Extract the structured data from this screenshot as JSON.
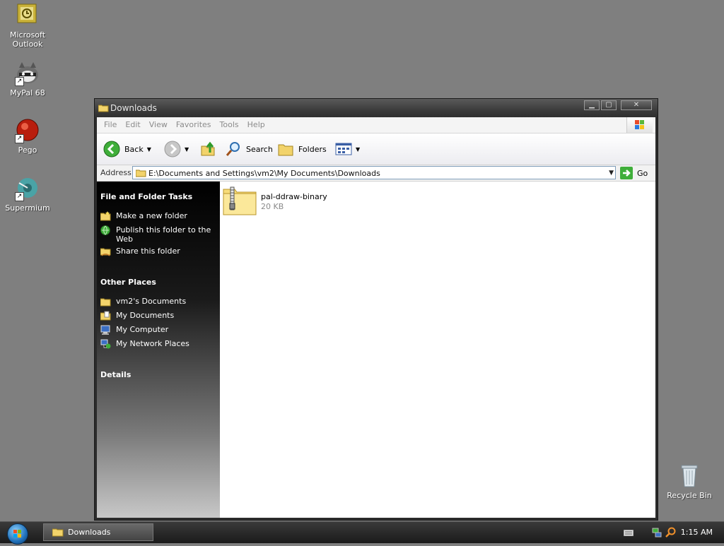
{
  "desktop": {
    "icons": [
      {
        "label": "Microsoft Outlook"
      },
      {
        "label": "MyPal 68"
      },
      {
        "label": "Pego"
      },
      {
        "label": "Supermium"
      },
      {
        "label": "Recycle Bin"
      }
    ]
  },
  "window": {
    "title": "Downloads",
    "menu": [
      "File",
      "Edit",
      "View",
      "Favorites",
      "Tools",
      "Help"
    ],
    "toolbar": {
      "back_label": "Back",
      "search_label": "Search",
      "folders_label": "Folders"
    },
    "address": {
      "label": "Address",
      "value": "E:\\Documents and Settings\\vm2\\My Documents\\Downloads",
      "go_label": "Go"
    },
    "sidepane": {
      "tasks_title": "File and Folder Tasks",
      "tasks": [
        "Make a new folder",
        "Publish this folder to the Web",
        "Share this folder"
      ],
      "places_title": "Other Places",
      "places": [
        "vm2's Documents",
        "My Documents",
        "My Computer",
        "My Network Places"
      ],
      "details_title": "Details"
    },
    "files": [
      {
        "name": "pal-ddraw-binary",
        "size": "20 KB"
      }
    ]
  },
  "taskbar": {
    "task_label": "Downloads",
    "clock": "1:15 AM"
  }
}
